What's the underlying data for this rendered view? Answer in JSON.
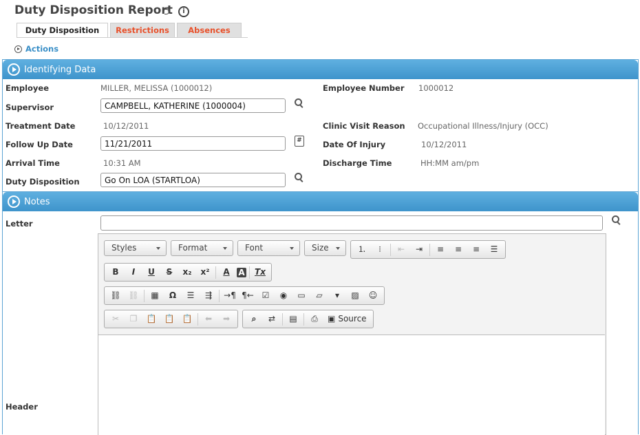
{
  "header": {
    "title": "Duty Disposition Report"
  },
  "tabs": [
    {
      "label": "Duty Disposition",
      "active": true
    },
    {
      "label": "Restrictions",
      "active": false
    },
    {
      "label": "Absences",
      "active": false
    }
  ],
  "actions": {
    "label": "Actions"
  },
  "identifying": {
    "title": "Identifying Data",
    "employee_label": "Employee",
    "employee_value": "MILLER, MELISSA (1000012)",
    "employee_number_label": "Employee Number",
    "employee_number_value": "1000012",
    "supervisor_label": "Supervisor",
    "supervisor_value": "CAMPBELL, KATHERINE (1000004)",
    "treatment_date_label": "Treatment Date",
    "treatment_date_value": "10/12/2011",
    "clinic_reason_label": "Clinic Visit Reason",
    "clinic_reason_value": "Occupational Illness/Injury (OCC)",
    "follow_up_label": "Follow Up Date",
    "follow_up_value": "11/21/2011",
    "date_injury_label": "Date Of Injury",
    "date_injury_value": "10/12/2011",
    "arrival_label": "Arrival Time",
    "arrival_value": "10:31 AM",
    "discharge_label": "Discharge Time",
    "discharge_value": "HH:MM am/pm",
    "duty_disp_label": "Duty Disposition",
    "duty_disp_value": "Go On LOA (STARTLOA)"
  },
  "notes": {
    "title": "Notes",
    "letter_label": "Letter",
    "letter_value": "",
    "header_label": "Header"
  },
  "editor": {
    "styles": "Styles",
    "format": "Format",
    "font": "Font",
    "size": "Size",
    "source": "Source",
    "glyphs": {
      "bold": "B",
      "italic": "I",
      "underline": "U",
      "strike": "S",
      "sub": "x₂",
      "sup": "x²",
      "text_color": "A",
      "bg_color": "A",
      "remove_format": "Tx",
      "omega": "Ω"
    }
  }
}
